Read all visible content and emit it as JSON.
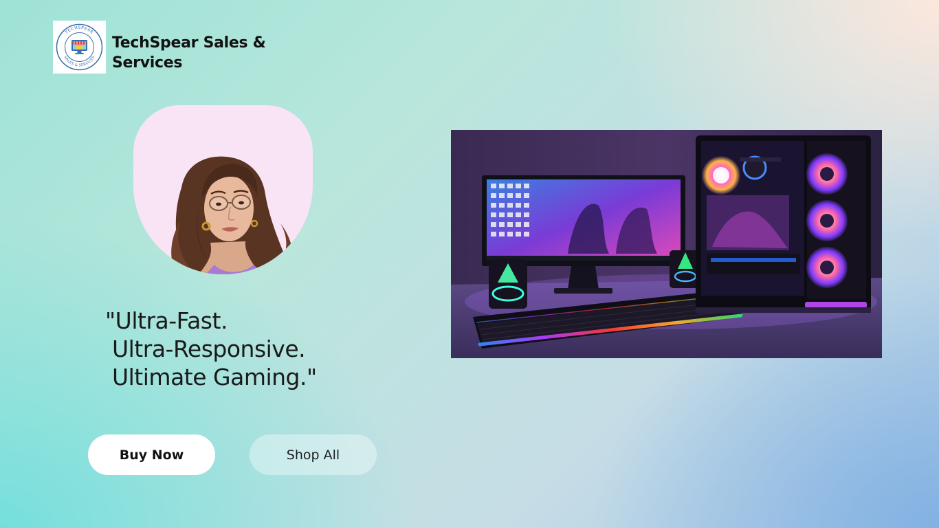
{
  "brand": {
    "name": "TechSpear Sales & Services",
    "logo_text_top": "TECHSPEAR",
    "logo_text_bottom": "SALES & SERVICES"
  },
  "hero": {
    "tagline_lines": [
      "\"Ultra-Fast.",
      " Ultra-Responsive.",
      " Ultimate Gaming.\""
    ]
  },
  "actions": {
    "buy_now_label": "Buy Now",
    "shop_all_label": "Shop All"
  },
  "colors": {
    "portrait_bg": "#f9e4f6",
    "primary_button_bg": "#ffffff",
    "secondary_button_bg": "rgba(255,255,255,0.38)",
    "text": "#111111"
  },
  "icons": {
    "logo": "store-monitor-badge-icon"
  }
}
